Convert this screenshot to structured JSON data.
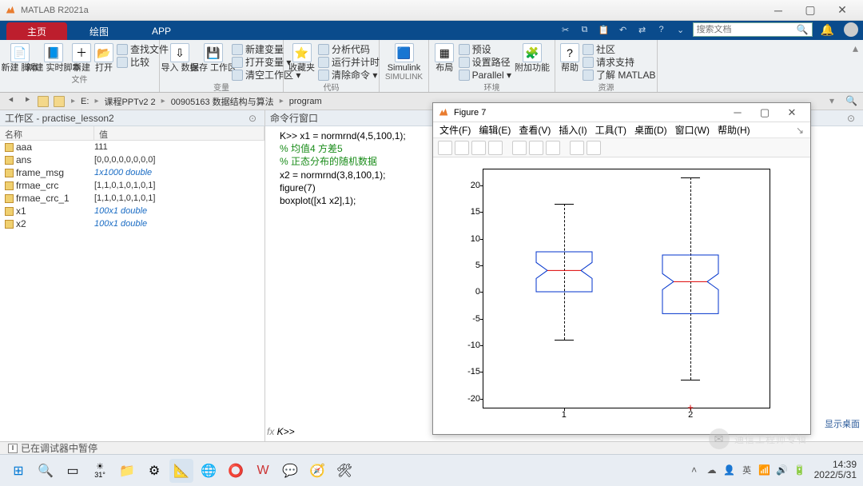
{
  "app": {
    "title": "MATLAB R2021a"
  },
  "tabs": {
    "home": "主页",
    "plot": "绘图",
    "app": "APP"
  },
  "search": {
    "placeholder": "搜索文档"
  },
  "ribbon": {
    "file": {
      "new_script": "新建\n脚本",
      "new_live": "新建\n实时脚本",
      "new": "新建",
      "open": "打开",
      "find_files": "查找文件",
      "compare": "比较",
      "label": "文件"
    },
    "var": {
      "import": "导入\n数据",
      "save_ws": "保存\n工作区",
      "new_var": "新建变量",
      "open_var": "打开变量 ▾",
      "clear_ws": "清空工作区 ▾",
      "label": "变量"
    },
    "code": {
      "fav": "收藏夹",
      "analyze": "分析代码",
      "timing": "运行并计时",
      "clear_cmd": "清除命令 ▾",
      "label": "代码"
    },
    "simulink": {
      "btn": "Simulink",
      "label": "SIMULINK"
    },
    "env": {
      "layout": "布局",
      "pref": "预设",
      "setpath": "设置路径",
      "parallel": "Parallel ▾",
      "addons": "附加功能",
      "label": "环境"
    },
    "res": {
      "help": "帮助",
      "community": "社区",
      "support": "请求支持",
      "learn": "了解 MATLAB",
      "label": "资源"
    }
  },
  "path": {
    "segs": [
      "E:",
      "课程PPTv2 2",
      "00905163 数据结构与算法",
      "program"
    ]
  },
  "workspace": {
    "title": "工作区 - practise_lesson2",
    "cols": {
      "name": "名称",
      "value": "值"
    },
    "rows": [
      {
        "name": "aaa",
        "value": "111",
        "link": false
      },
      {
        "name": "ans",
        "value": "[0,0,0,0,0,0,0,0]",
        "link": false
      },
      {
        "name": "frame_msg",
        "value": "1x1000 double",
        "link": true
      },
      {
        "name": "frmae_crc",
        "value": "[1,1,0,1,0,1,0,1]",
        "link": false
      },
      {
        "name": "frmae_crc_1",
        "value": "[1,1,0,1,0,1,0,1]",
        "link": false
      },
      {
        "name": "x1",
        "value": "100x1 double",
        "link": true
      },
      {
        "name": "x2",
        "value": "100x1 double",
        "link": true
      }
    ]
  },
  "cmd": {
    "title": "命令行窗口",
    "lines": [
      {
        "t": "K>> x1 = normrnd(4,5,100,1);",
        "c": false
      },
      {
        "t": "% 均值4 方差5",
        "c": true
      },
      {
        "t": "% 正态分布的随机数据",
        "c": true
      },
      {
        "t": "x2 = normrnd(3,8,100,1);",
        "c": false
      },
      {
        "t": "figure(7)",
        "c": false
      },
      {
        "t": "boxplot([x1 x2],1);",
        "c": false
      }
    ],
    "prompt": "K>>"
  },
  "figure": {
    "title": "Figure 7",
    "menu": [
      "文件(F)",
      "编辑(E)",
      "查看(V)",
      "插入(I)",
      "工具(T)",
      "桌面(D)",
      "窗口(W)",
      "帮助(H)"
    ]
  },
  "chart_data": {
    "type": "boxplot",
    "categories": [
      "1",
      "2"
    ],
    "yticks": [
      -20,
      -15,
      -10,
      -5,
      0,
      5,
      10,
      15,
      20
    ],
    "ylim": [
      -22,
      23
    ],
    "series": [
      {
        "name": "1",
        "q1": 0,
        "median": 4,
        "q3": 7.5,
        "whisker_low": -9,
        "whisker_high": 16.5,
        "outliers": []
      },
      {
        "name": "2",
        "q1": -4,
        "median": 2,
        "q3": 7,
        "whisker_low": -16.5,
        "whisker_high": 21.5,
        "outliers": [
          -21.5
        ]
      }
    ]
  },
  "status": {
    "paused": "已在调试器中暂停"
  },
  "desktop": {
    "show": "显示桌面"
  },
  "watermark": "通信工程师专辑",
  "clock": {
    "time": "14:39",
    "date": "2022/5/31"
  },
  "tray": {
    "ime": "英",
    "weather": "31°"
  }
}
